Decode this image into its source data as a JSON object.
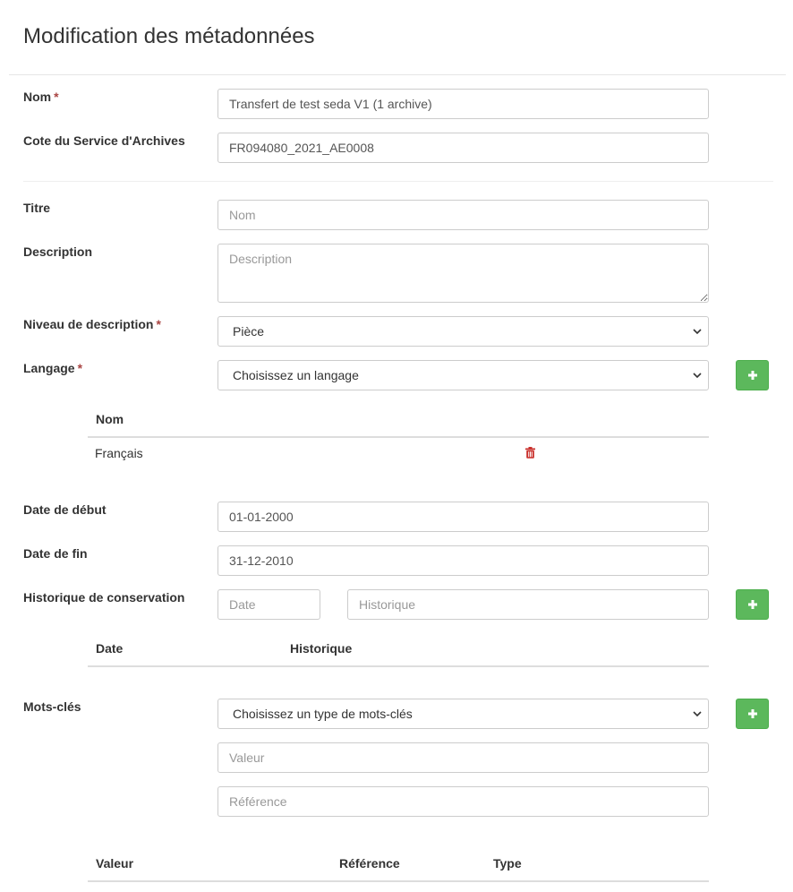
{
  "page": {
    "title": "Modification des métadonnées"
  },
  "fields": {
    "nom": {
      "label": "Nom",
      "required_mark": "*",
      "value": "Transfert de test seda V1 (1 archive)"
    },
    "cote": {
      "label": "Cote du Service d'Archives",
      "value": "FR094080_2021_AE0008"
    },
    "titre": {
      "label": "Titre",
      "placeholder": "Nom"
    },
    "description": {
      "label": "Description",
      "placeholder": "Description"
    },
    "niveau": {
      "label": "Niveau de description",
      "required_mark": "*",
      "selected": "Pièce"
    },
    "langage": {
      "label": "Langage",
      "required_mark": "*",
      "selected": "Choisissez un langage",
      "table": {
        "headers": [
          "Nom"
        ],
        "rows": [
          {
            "nom": "Français"
          }
        ]
      }
    },
    "date_debut": {
      "label": "Date de début",
      "value": "01-01-2000"
    },
    "date_fin": {
      "label": "Date de fin",
      "value": "31-12-2010"
    },
    "historique": {
      "label": "Historique de conservation",
      "date_placeholder": "Date",
      "historique_placeholder": "Historique",
      "table": {
        "headers": [
          "Date",
          "Historique"
        ]
      }
    },
    "mots_cles": {
      "label": "Mots-clés",
      "selected": "Choisissez un type de mots-clés",
      "valeur_placeholder": "Valeur",
      "reference_placeholder": "Référence",
      "table": {
        "headers": [
          "Valeur",
          "Référence",
          "Type"
        ]
      }
    }
  },
  "icons": {
    "add": "plus-icon",
    "delete": "trash-icon"
  },
  "colors": {
    "add_button": "#5cb85c",
    "required": "#a94442",
    "delete_icon": "#c9302c"
  }
}
